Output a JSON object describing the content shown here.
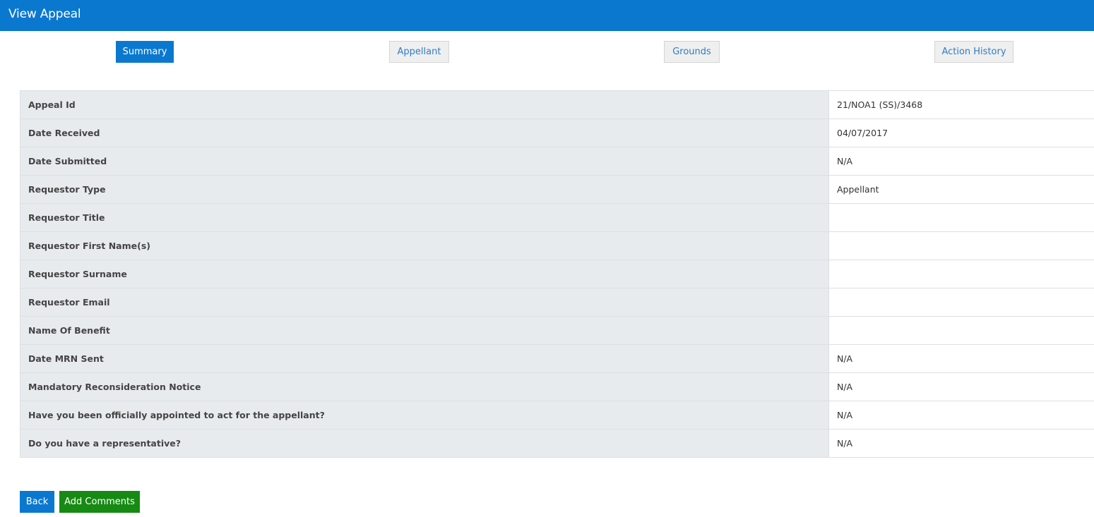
{
  "header": {
    "title": "View Appeal"
  },
  "tabs": [
    {
      "label": "Summary",
      "active": true
    },
    {
      "label": "Appellant",
      "active": false
    },
    {
      "label": "Grounds",
      "active": false
    },
    {
      "label": "Action History",
      "active": false
    }
  ],
  "details": [
    {
      "label": "Appeal Id",
      "value": "21/NOA1 (SS)/3468"
    },
    {
      "label": "Date Received",
      "value": "04/07/2017"
    },
    {
      "label": "Date Submitted",
      "value": "N/A"
    },
    {
      "label": "Requestor Type",
      "value": "Appellant"
    },
    {
      "label": "Requestor Title",
      "value": ""
    },
    {
      "label": "Requestor First Name(s)",
      "value": ""
    },
    {
      "label": "Requestor Surname",
      "value": ""
    },
    {
      "label": "Requestor Email",
      "value": ""
    },
    {
      "label": "Name Of Benefit",
      "value": ""
    },
    {
      "label": "Date MRN Sent",
      "value": "N/A"
    },
    {
      "label": "Mandatory Reconsideration Notice",
      "value": "N/A"
    },
    {
      "label": "Have you been officially appointed to act for the appellant?",
      "value": "N/A"
    },
    {
      "label": "Do you have a representative?",
      "value": "N/A"
    }
  ],
  "buttons": {
    "back": "Back",
    "add_comments": "Add Comments"
  },
  "colors": {
    "primary": "#0b78d0",
    "success": "#168a13",
    "label_bg": "#e8ebee"
  }
}
